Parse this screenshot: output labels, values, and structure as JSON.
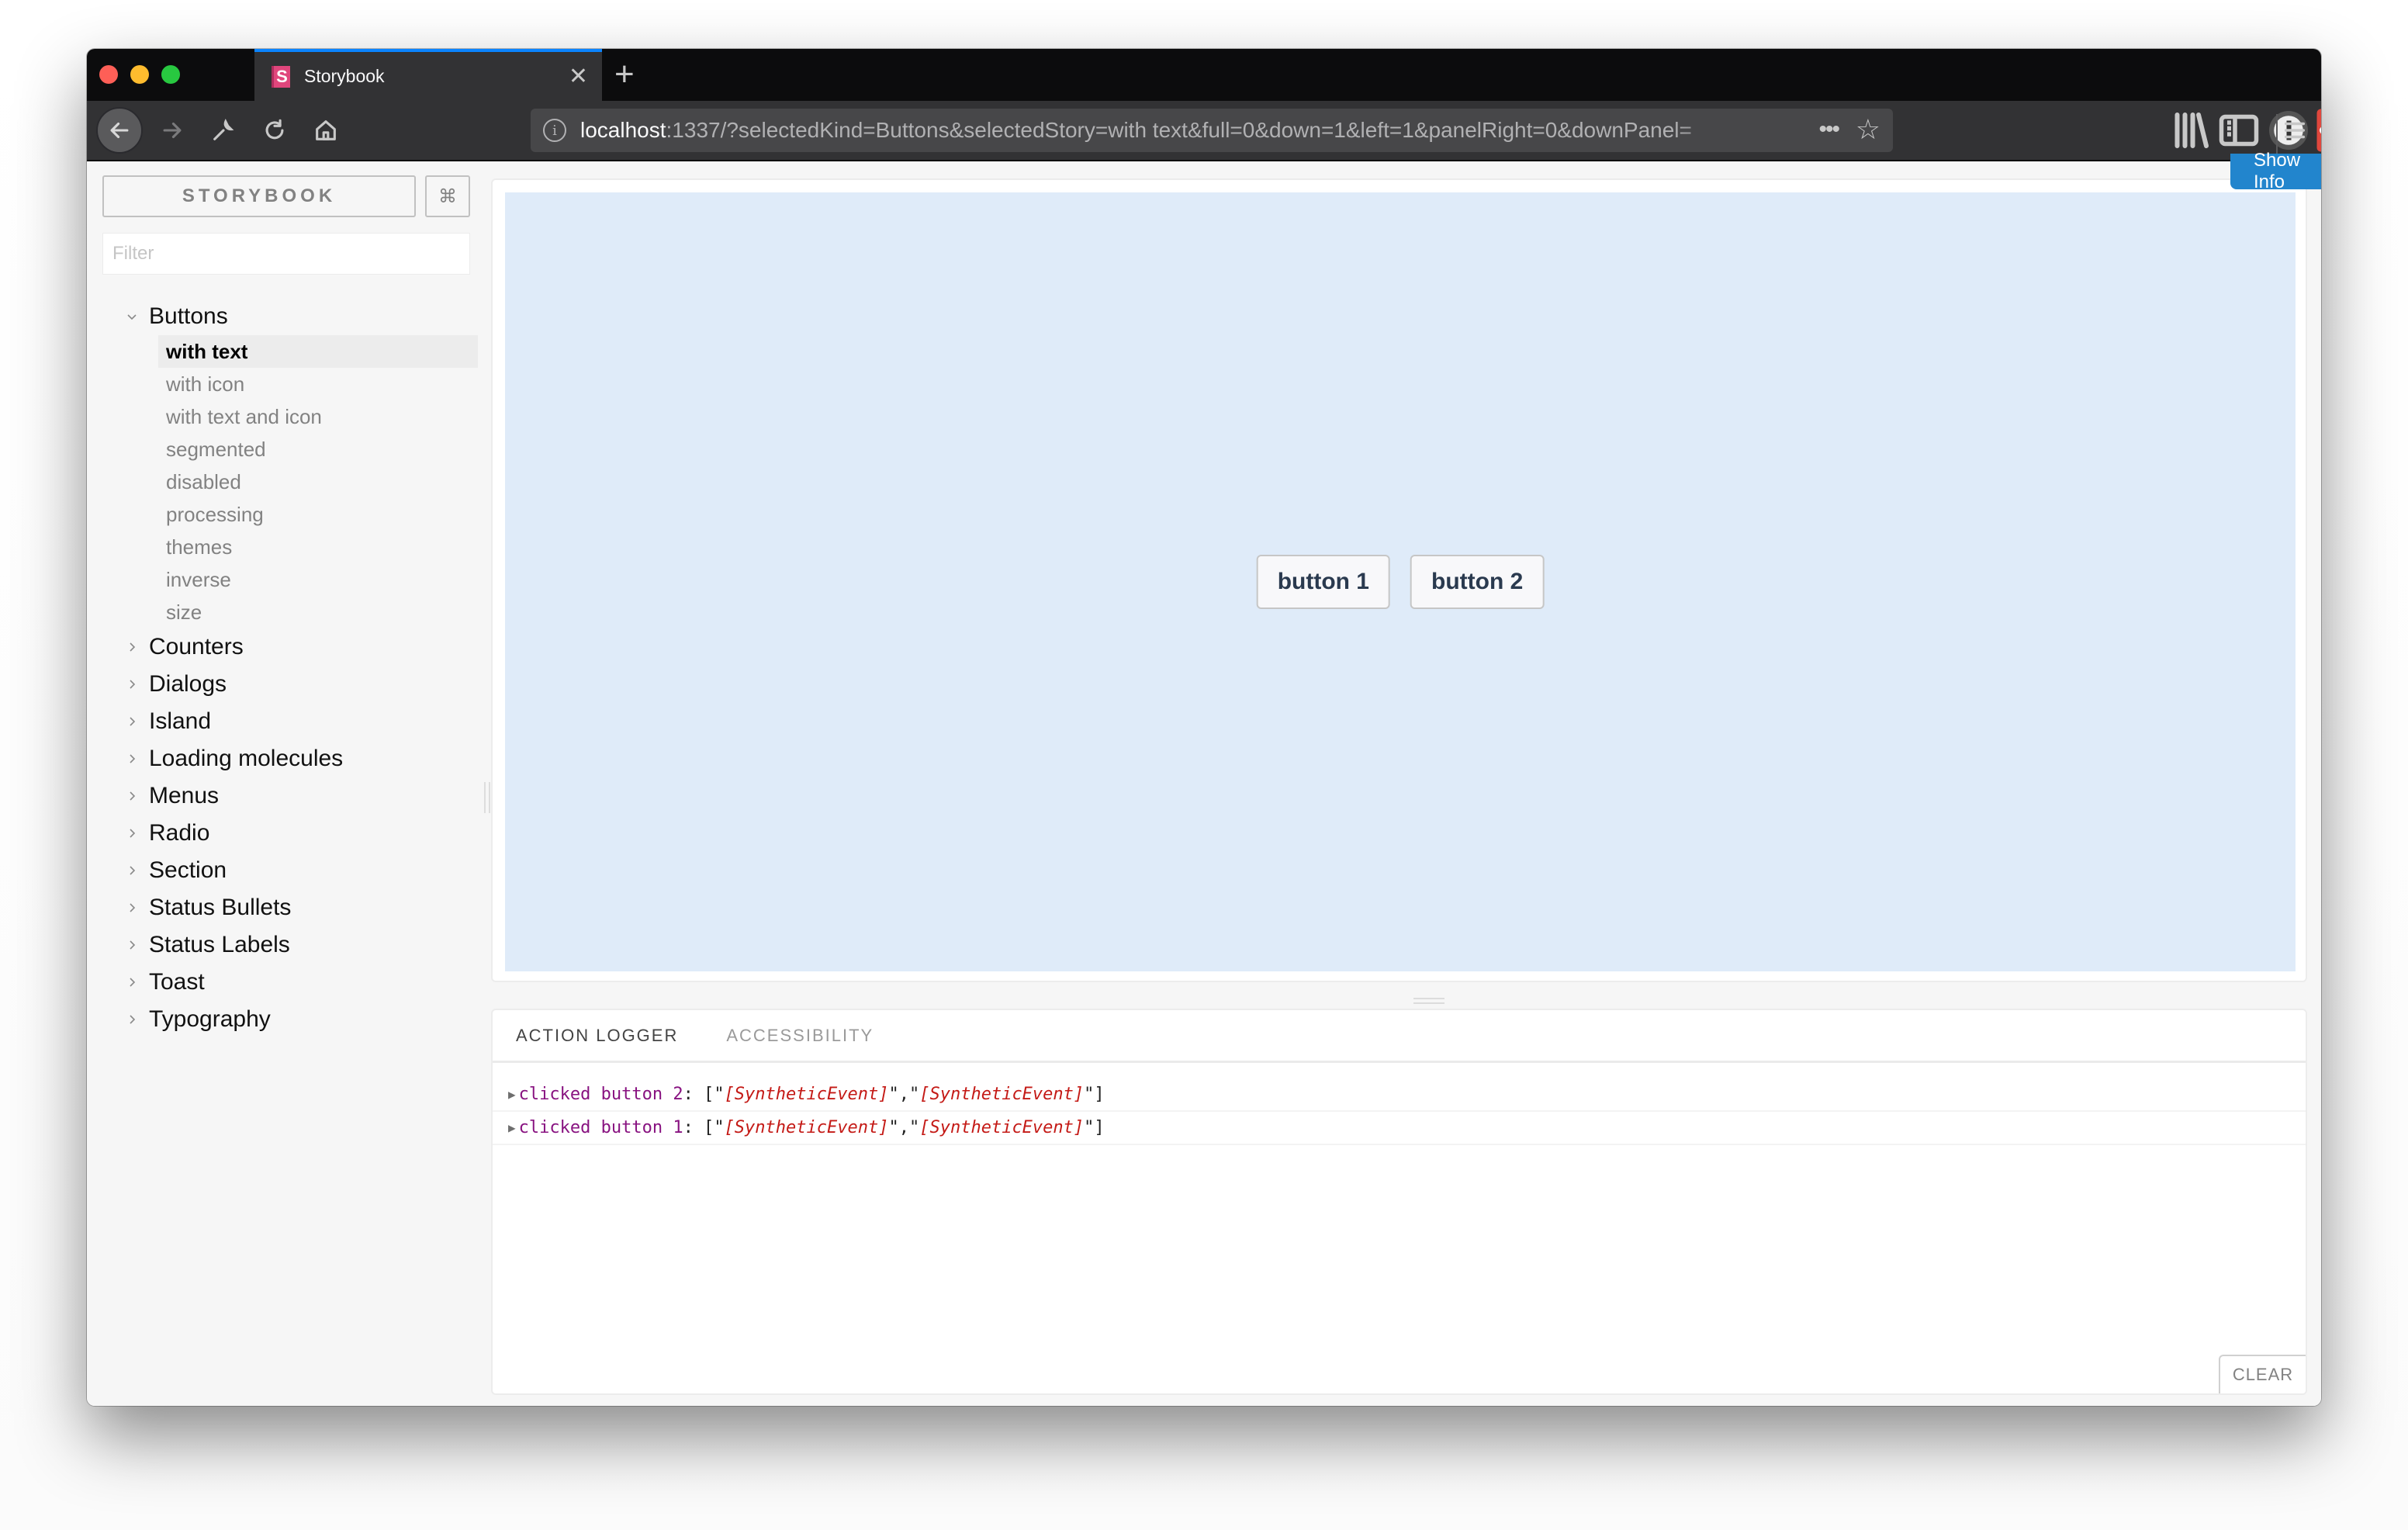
{
  "browser": {
    "tab": {
      "title": "Storybook",
      "favicon_letter": "S",
      "favicon_color": "#e0467c"
    },
    "url": {
      "host": "localhost",
      "rest": ":1337/?selectedKind=Buttons&selectedStory=with text&full=0&down=1&left=1&panelRight=0&downPanel="
    },
    "page_actions_label": "•••",
    "accent_color": "#0a84ff"
  },
  "sidebar": {
    "brand_label": "STORYBOOK",
    "shortcut_label": "⌘",
    "filter": {
      "placeholder": "Filter",
      "value": ""
    },
    "kinds": [
      {
        "label": "Buttons",
        "expanded": true,
        "stories": [
          {
            "label": "with text",
            "selected": true
          },
          {
            "label": "with icon"
          },
          {
            "label": "with text and icon"
          },
          {
            "label": "segmented"
          },
          {
            "label": "disabled"
          },
          {
            "label": "processing"
          },
          {
            "label": "themes"
          },
          {
            "label": "inverse"
          },
          {
            "label": "size"
          }
        ]
      },
      {
        "label": "Counters",
        "expanded": false
      },
      {
        "label": "Dialogs",
        "expanded": false
      },
      {
        "label": "Island",
        "expanded": false
      },
      {
        "label": "Loading molecules",
        "expanded": false
      },
      {
        "label": "Menus",
        "expanded": false
      },
      {
        "label": "Radio",
        "expanded": false
      },
      {
        "label": "Section",
        "expanded": false
      },
      {
        "label": "Status Bullets",
        "expanded": false
      },
      {
        "label": "Status Labels",
        "expanded": false
      },
      {
        "label": "Toast",
        "expanded": false
      },
      {
        "label": "Typography",
        "expanded": false
      }
    ]
  },
  "preview": {
    "show_info_label": "Show Info",
    "show_info_color": "#2285cd",
    "background_color": "#dfebf9",
    "buttons": [
      {
        "label": "button 1"
      },
      {
        "label": "button 2"
      }
    ]
  },
  "addon_panel": {
    "tabs": [
      {
        "label": "ACTION LOGGER",
        "active": true
      },
      {
        "label": "ACCESSIBILITY",
        "active": false
      }
    ],
    "log": [
      {
        "name": "clicked button 2",
        "args": [
          "[SyntheticEvent]",
          "[SyntheticEvent]"
        ]
      },
      {
        "name": "clicked button 1",
        "args": [
          "[SyntheticEvent]",
          "[SyntheticEvent]"
        ]
      }
    ],
    "clear_label": "CLEAR"
  }
}
